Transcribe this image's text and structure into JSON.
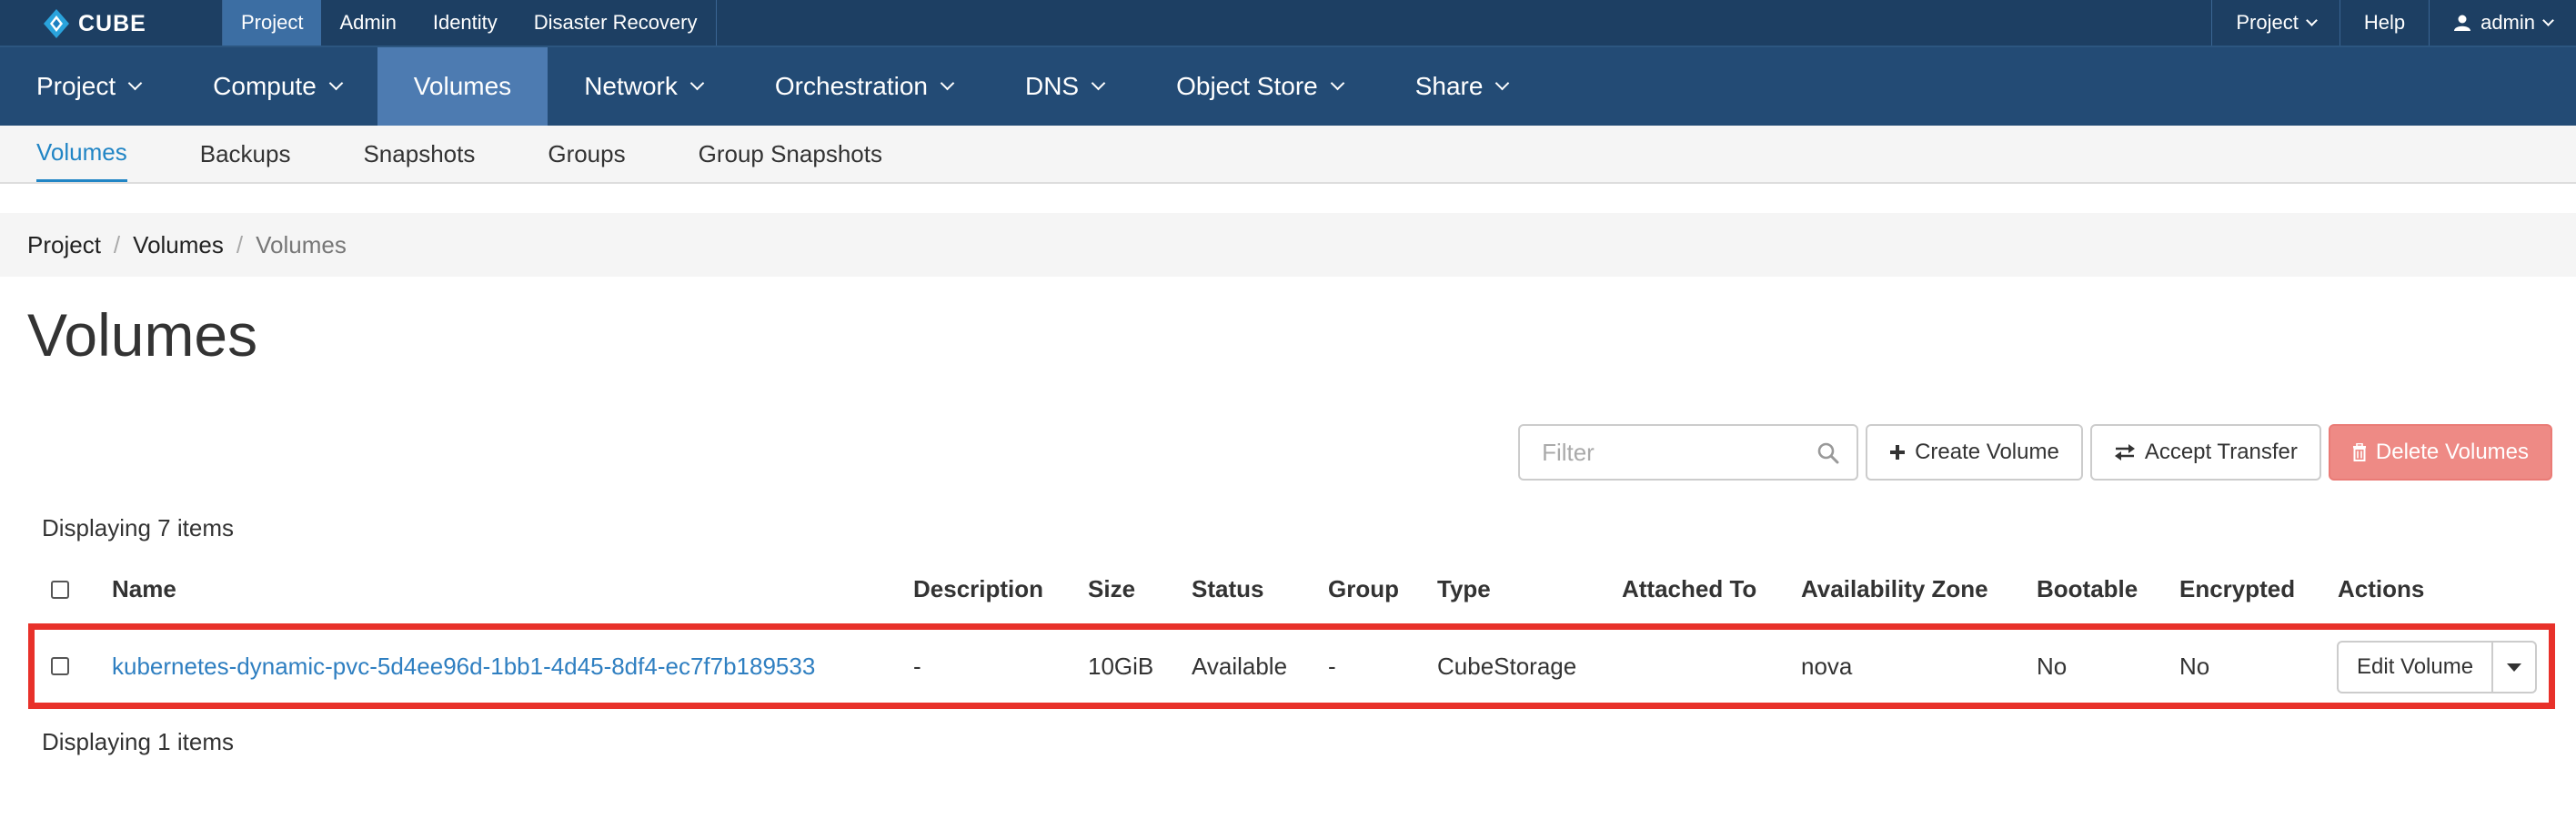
{
  "brand": {
    "name": "CUBE"
  },
  "top_sections": [
    {
      "label": "Project",
      "active": true
    },
    {
      "label": "Admin",
      "active": false
    },
    {
      "label": "Identity",
      "active": false
    },
    {
      "label": "Disaster Recovery",
      "active": false
    }
  ],
  "top_right": {
    "project_label": "Project",
    "help_label": "Help",
    "user_label": "admin"
  },
  "main_nav": [
    {
      "label": "Project",
      "dropdown": true
    },
    {
      "label": "Compute",
      "dropdown": true
    },
    {
      "label": "Volumes",
      "dropdown": false,
      "active": true
    },
    {
      "label": "Network",
      "dropdown": true
    },
    {
      "label": "Orchestration",
      "dropdown": true
    },
    {
      "label": "DNS",
      "dropdown": true
    },
    {
      "label": "Object Store",
      "dropdown": true
    },
    {
      "label": "Share",
      "dropdown": true
    }
  ],
  "sub_nav": [
    {
      "label": "Volumes",
      "active": true
    },
    {
      "label": "Backups"
    },
    {
      "label": "Snapshots"
    },
    {
      "label": "Groups"
    },
    {
      "label": "Group Snapshots"
    }
  ],
  "breadcrumb": {
    "items": [
      "Project",
      "Volumes"
    ],
    "current": "Volumes"
  },
  "page_title": "Volumes",
  "toolbar": {
    "filter_placeholder": "Filter",
    "create_label": "Create Volume",
    "accept_label": "Accept Transfer",
    "delete_label": "Delete Volumes"
  },
  "table": {
    "count_top": "Displaying 7 items",
    "count_bottom": "Displaying 1 items",
    "headers": {
      "name": "Name",
      "description": "Description",
      "size": "Size",
      "status": "Status",
      "group": "Group",
      "type": "Type",
      "attached_to": "Attached To",
      "availability_zone": "Availability Zone",
      "bootable": "Bootable",
      "encrypted": "Encrypted",
      "actions": "Actions"
    },
    "rows": [
      {
        "name": "kubernetes-dynamic-pvc-5d4ee96d-1bb1-4d45-8df4-ec7f7b189533",
        "description": "-",
        "size": "10GiB",
        "status": "Available",
        "group": "-",
        "type": "CubeStorage",
        "attached_to": "",
        "availability_zone": "nova",
        "bootable": "No",
        "encrypted": "No",
        "action_label": "Edit Volume"
      }
    ]
  },
  "colors": {
    "topbar": "#1d3f63",
    "mainnav": "#234b75",
    "active_nav": "#4d7bb1",
    "link": "#2f7fc1",
    "danger": "#ee8a85",
    "highlight": "#e8312a"
  }
}
